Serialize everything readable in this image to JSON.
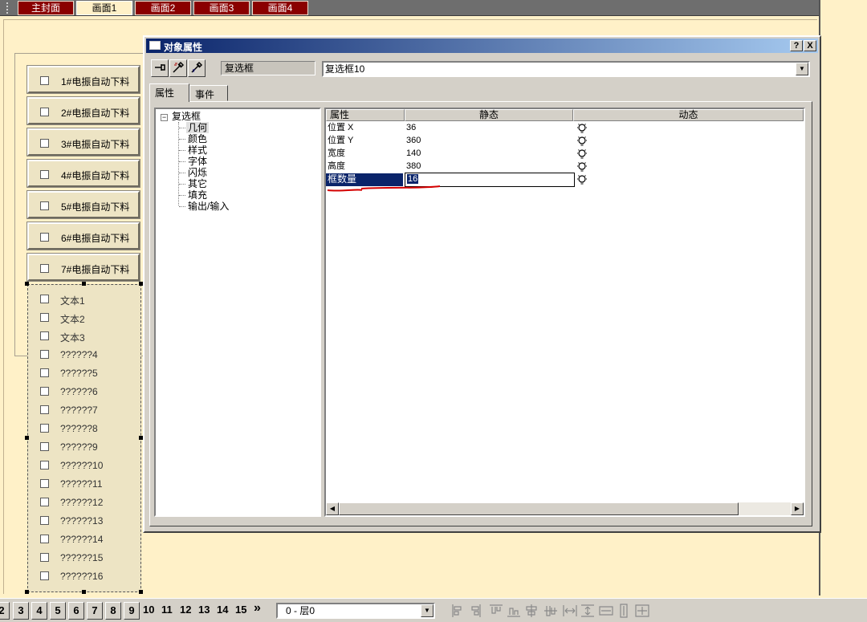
{
  "screen_tabs": [
    "主封面",
    "画面1",
    "画面2",
    "画面3",
    "画面4"
  ],
  "active_screen_tab": "画面1",
  "left_buttons": [
    "1#电振自动下料",
    "2#电振自动下料",
    "3#电振自动下料",
    "4#电振自动下料",
    "5#电振自动下料",
    "6#电振自动下料",
    "7#电振自动下料"
  ],
  "checkbox_group": [
    "文本1",
    "文本2",
    "文本3",
    "??????4",
    "??????5",
    "??????6",
    "??????7",
    "??????8",
    "??????9",
    "??????10",
    "??????11",
    "??????12",
    "??????13",
    "??????14",
    "??????15",
    "??????16"
  ],
  "dialog": {
    "title": "对象属性",
    "help_label": "?",
    "close_label": "X",
    "object_type": "复选框",
    "object_name": "复选框10",
    "tabs": [
      "属性",
      "事件"
    ],
    "tree": {
      "root": "复选框",
      "children": [
        "几何",
        "颜色",
        "样式",
        "字体",
        "闪烁",
        "其它",
        "填充",
        "输出/输入"
      ],
      "selected": "几何"
    },
    "grid": {
      "headers": [
        "属性",
        "静态",
        "动态"
      ],
      "rows": [
        {
          "name": "位置 X",
          "value": "36"
        },
        {
          "name": "位置 Y",
          "value": "360"
        },
        {
          "name": "宽度",
          "value": "140"
        },
        {
          "name": "高度",
          "value": "380"
        },
        {
          "name": "框数量",
          "value": "16"
        }
      ],
      "selected_row": "框数量"
    }
  },
  "bottom_bar": {
    "page_buttons": [
      "2",
      "3",
      "4",
      "5",
      "6",
      "7",
      "8",
      "9"
    ],
    "page_numbers_plain": [
      "10",
      "11",
      "12",
      "13",
      "14",
      "15"
    ],
    "more_label": "»",
    "layer_value": "0 - 层0"
  },
  "colors": {
    "canvas_bg": "#fff1c8",
    "tab_red": "#8a0000",
    "title_blue": "#0a246a",
    "selection_blue": "#0a246a",
    "annotation_red": "#d40000"
  }
}
